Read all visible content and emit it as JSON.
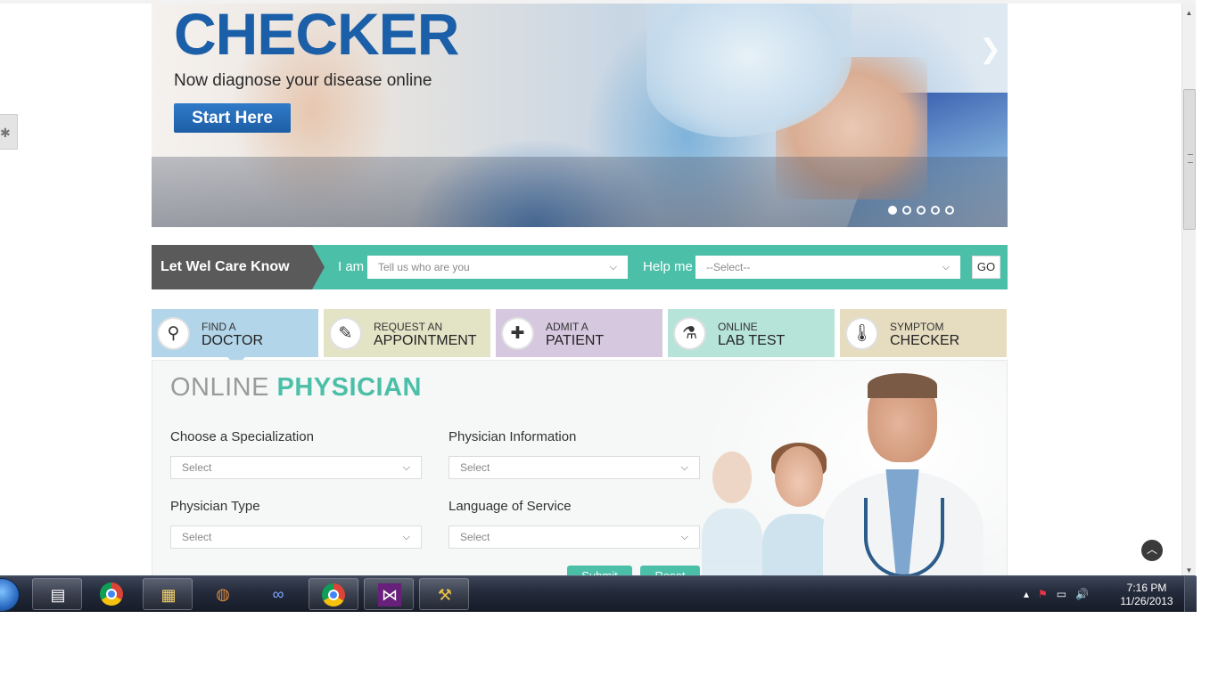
{
  "hero": {
    "title": "CHECKER",
    "tagline": "Now diagnose your disease online",
    "cta": "Start Here",
    "next_icon": "chevron-right-icon",
    "dots_count": 5,
    "active_dot": 0
  },
  "search_bar": {
    "brand": "Let Wel Care Know",
    "iam_label": "I am",
    "iam_placeholder": "Tell us who are you",
    "help_label": "Help me",
    "help_value": "--Select--",
    "go": "GO"
  },
  "tabs": [
    {
      "line1": "FIND A",
      "line2": "DOCTOR",
      "icon": "search-icon",
      "bg": "#b3d5e9"
    },
    {
      "line1": "REQUEST AN",
      "line2": "APPOINTMENT",
      "icon": "notepad-icon",
      "bg": "#e3e4c6"
    },
    {
      "line1": "ADMIT A",
      "line2": "PATIENT",
      "icon": "medical-bag-icon",
      "bg": "#d5c8df"
    },
    {
      "line1": "ONLINE",
      "line2": "LAB TEST",
      "icon": "test-tube-icon",
      "bg": "#b7e4d9"
    },
    {
      "line1": "SYMPTOM",
      "line2": "CHECKER",
      "icon": "thermometer-icon",
      "bg": "#e6dcc0"
    }
  ],
  "panel": {
    "title_light": "ONLINE",
    "title_bold": "PHYSICIAN",
    "fields": {
      "specialization": {
        "label": "Choose a Specialization",
        "value": "Select"
      },
      "info": {
        "label": "Physician Information",
        "value": "Select"
      },
      "type": {
        "label": "Physician Type",
        "value": "Select"
      },
      "language": {
        "label": "Language of Service",
        "value": "Select"
      }
    },
    "submit": "Submit",
    "reset": "Reset"
  },
  "taskbar": {
    "time": "7:16 PM",
    "date": "11/26/2013",
    "apps": [
      "notepad-icon",
      "chrome-icon",
      "file-explorer-icon",
      "basketball-app-icon",
      "infinity-app-icon",
      "chrome-icon",
      "visual-studio-icon",
      "tools-icon"
    ]
  },
  "colors": {
    "accent": "#4cbfa8",
    "brand_dark": "#5a5a5a",
    "title_blue": "#1b5fa8"
  }
}
